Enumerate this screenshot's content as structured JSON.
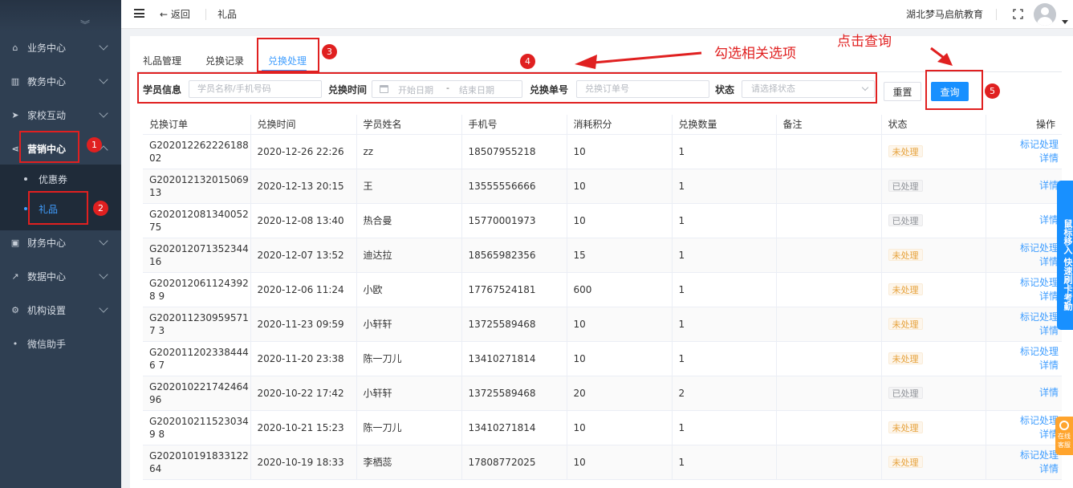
{
  "sidebar": {
    "items": [
      {
        "label": "业务中心",
        "icon": "headset-icon"
      },
      {
        "label": "教务中心",
        "icon": "book-icon"
      },
      {
        "label": "家校互动",
        "icon": "send-icon"
      },
      {
        "label": "营销中心",
        "icon": "share-icon"
      },
      {
        "label": "财务中心",
        "icon": "wallet-icon"
      },
      {
        "label": "数据中心",
        "icon": "chart-icon"
      },
      {
        "label": "机构设置",
        "icon": "gear-icon"
      },
      {
        "label": "微信助手",
        "icon": "dot"
      }
    ],
    "submenu": [
      "优惠券",
      "礼品"
    ]
  },
  "header": {
    "back_label": "返回",
    "breadcrumb": "礼品",
    "org_name": "湖北梦马启航教育"
  },
  "tabs": [
    "礼品管理",
    "兑换记录",
    "兑换处理"
  ],
  "filters": {
    "student_label": "学员信息",
    "student_placeholder": "学员名称/手机号码",
    "time_label": "兑换时间",
    "start_placeholder": "开始日期",
    "dash": "-",
    "end_placeholder": "结束日期",
    "order_label": "兑换单号",
    "order_placeholder": "兑换订单号",
    "status_label": "状态",
    "status_placeholder": "请选择状态",
    "reset_label": "重置",
    "query_label": "查询"
  },
  "table": {
    "headers": [
      "兑换订单",
      "兑换时间",
      "学员姓名",
      "手机号",
      "消耗积分",
      "兑换数量",
      "备注",
      "状态",
      "操作"
    ],
    "rows": [
      {
        "order": "G20201226222618802",
        "time": "2020-12-26 22:26",
        "name": "zz",
        "phone": "18507955218",
        "points": "10",
        "qty": "1",
        "note": "",
        "status": "未处理",
        "pending": true
      },
      {
        "order": "G20201213201506913",
        "time": "2020-12-13 20:15",
        "name": "王",
        "phone": "13555556666",
        "points": "10",
        "qty": "1",
        "note": "",
        "status": "已处理",
        "pending": false
      },
      {
        "order": "G20201208134005275",
        "time": "2020-12-08 13:40",
        "name": "热合曼",
        "phone": "15770001973",
        "points": "10",
        "qty": "1",
        "note": "",
        "status": "已处理",
        "pending": false
      },
      {
        "order": "G20201207135234416",
        "time": "2020-12-07 13:52",
        "name": "迪达拉",
        "phone": "18565982356",
        "points": "15",
        "qty": "1",
        "note": "",
        "status": "未处理",
        "pending": true
      },
      {
        "order": "G2020120611243928 9",
        "time": "2020-12-06 11:24",
        "name": "小欧",
        "phone": "17767524181",
        "points": "600",
        "qty": "1",
        "note": "",
        "status": "未处理",
        "pending": true
      },
      {
        "order": "G2020112309595717 3",
        "time": "2020-11-23 09:59",
        "name": "小轩轩",
        "phone": "13725589468",
        "points": "10",
        "qty": "1",
        "note": "",
        "status": "未处理",
        "pending": true
      },
      {
        "order": "G2020112023384446 7",
        "time": "2020-11-20 23:38",
        "name": "陈一刀儿",
        "phone": "13410271814",
        "points": "10",
        "qty": "1",
        "note": "",
        "status": "未处理",
        "pending": true
      },
      {
        "order": "G20201022174246496",
        "time": "2020-10-22 17:42",
        "name": "小轩轩",
        "phone": "13725589468",
        "points": "20",
        "qty": "2",
        "note": "",
        "status": "已处理",
        "pending": false
      },
      {
        "order": "G2020102115230349 8",
        "time": "2020-10-21 15:23",
        "name": "陈一刀儿",
        "phone": "13410271814",
        "points": "10",
        "qty": "1",
        "note": "",
        "status": "未处理",
        "pending": true
      },
      {
        "order": "G20201019183312264",
        "time": "2020-10-19 18:33",
        "name": "李栖蕊",
        "phone": "17808772025",
        "points": "10",
        "qty": "1",
        "note": "",
        "status": "未处理",
        "pending": true
      }
    ],
    "op_mark": "标记处理",
    "op_detail": "详情"
  },
  "annotations": {
    "badges": [
      "1",
      "2",
      "3",
      "4",
      "5"
    ],
    "check_note": "勾选相关选项",
    "query_note": "点击查询"
  },
  "floating": {
    "quick_tab": "鼠标移入 快速刷卡考勤",
    "service": "在线客服"
  },
  "colors": {
    "primary": "#1890ff",
    "sidebar": "#2f3f52",
    "annotation": "#e02020",
    "pending": "#e6a23c"
  }
}
